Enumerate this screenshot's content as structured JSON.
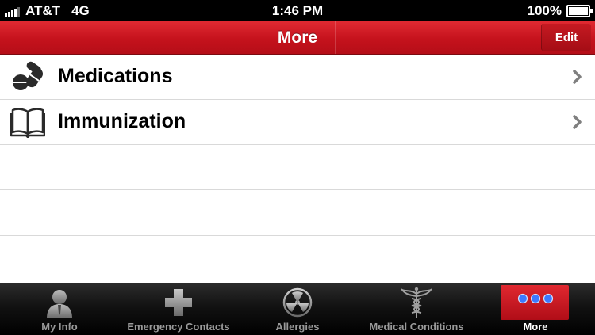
{
  "status_bar": {
    "carrier": "AT&T",
    "network": "4G",
    "time": "1:46 PM",
    "battery": "100%"
  },
  "nav": {
    "title": "More",
    "edit_label": "Edit"
  },
  "list": {
    "items": [
      {
        "label": "Medications",
        "icon": "pills-icon"
      },
      {
        "label": "Immunization",
        "icon": "book-icon"
      }
    ]
  },
  "tabs": [
    {
      "label": "My Info",
      "icon": "person-icon",
      "active": false
    },
    {
      "label": "Emergency Contacts",
      "icon": "plus-cross-icon",
      "active": false
    },
    {
      "label": "Allergies",
      "icon": "radiation-icon",
      "active": false
    },
    {
      "label": "Medical Conditions",
      "icon": "caduceus-icon",
      "active": false
    },
    {
      "label": "More",
      "icon": "more-dots-icon",
      "active": true
    }
  ],
  "colors": {
    "accent_red": "#c5121c",
    "more_dots": "#3d79ff"
  }
}
